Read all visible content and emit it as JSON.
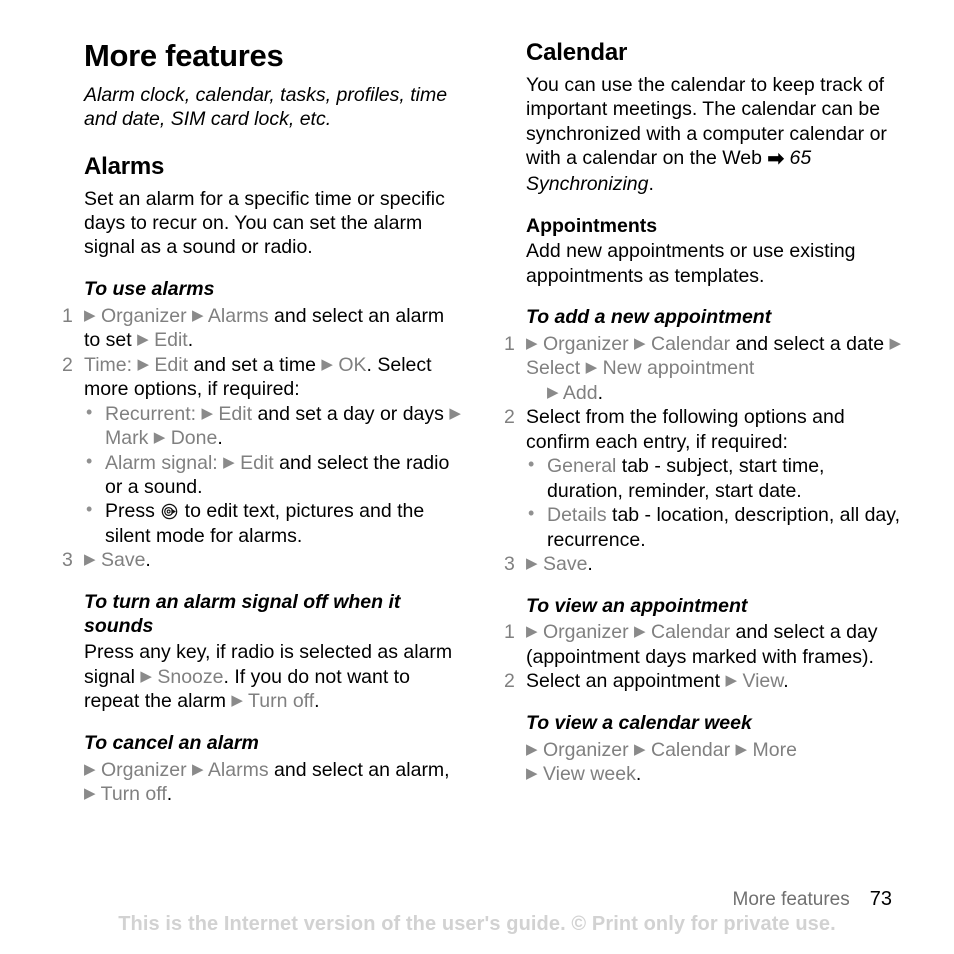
{
  "page": {
    "title": "More features",
    "subtitle": "Alarm clock, calendar, tasks, profiles, time and date, SIM card lock, etc.",
    "page_number": "73",
    "footer_section": "More features",
    "watermark": "This is the Internet version of the user's guide. © Print only for private use."
  },
  "colors": {
    "menu_path": "#808080",
    "body_text": "#000000",
    "watermark": "#d2d2d2"
  },
  "icons": {
    "menu_arrow": "▶",
    "cross_reference_arrow": "➡",
    "bullet": "•",
    "joystick": "joystick-icon"
  },
  "left_column": {
    "heading": "Alarms",
    "intro": "Set an alarm for a specific time or specific days to recur on. You can set the alarm signal as a sound or radio.",
    "procedures": [
      {
        "title": "To use alarms",
        "steps": [
          {
            "number": "1",
            "parts": [
              {
                "t": "arrow"
              },
              {
                "t": "mp",
                "v": "Organizer "
              },
              {
                "t": "arrow"
              },
              {
                "t": "mp",
                "v": "Alarms "
              },
              {
                "t": "plain",
                "v": "and select an alarm to set "
              },
              {
                "t": "arrow"
              },
              {
                "t": "mp",
                "v": "Edit"
              },
              {
                "t": "plain",
                "v": "."
              }
            ]
          },
          {
            "number": "2",
            "parts": [
              {
                "t": "mp",
                "v": "Time: "
              },
              {
                "t": "arrow"
              },
              {
                "t": "mp",
                "v": "Edit "
              },
              {
                "t": "plain",
                "v": "and set a time "
              },
              {
                "t": "arrow"
              },
              {
                "t": "mp",
                "v": "OK"
              },
              {
                "t": "plain",
                "v": ". Select more options, if required:"
              }
            ],
            "bullets": [
              [
                {
                  "t": "mp",
                  "v": "Recurrent: "
                },
                {
                  "t": "arrow"
                },
                {
                  "t": "mp",
                  "v": "Edit "
                },
                {
                  "t": "plain",
                  "v": "and set a day or days "
                },
                {
                  "t": "arrow"
                },
                {
                  "t": "mp",
                  "v": "Mark "
                },
                {
                  "t": "arrow"
                },
                {
                  "t": "mp",
                  "v": "Done"
                },
                {
                  "t": "plain",
                  "v": "."
                }
              ],
              [
                {
                  "t": "mp",
                  "v": "Alarm signal: "
                },
                {
                  "t": "arrow"
                },
                {
                  "t": "mp",
                  "v": "Edit "
                },
                {
                  "t": "plain",
                  "v": "and select the radio or a sound."
                }
              ],
              [
                {
                  "t": "plain",
                  "v": "Press "
                },
                {
                  "t": "joystick"
                },
                {
                  "t": "plain",
                  "v": " to edit text, pictures and the silent mode for alarms."
                }
              ]
            ]
          },
          {
            "number": "3",
            "parts": [
              {
                "t": "arrow"
              },
              {
                "t": "mp",
                "v": "Save"
              },
              {
                "t": "plain",
                "v": "."
              }
            ]
          }
        ]
      },
      {
        "title": "To turn an alarm signal off when it sounds",
        "body_parts": [
          {
            "t": "plain",
            "v": "Press any key, if radio is selected as alarm signal "
          },
          {
            "t": "arrow"
          },
          {
            "t": "mp",
            "v": "Snooze"
          },
          {
            "t": "plain",
            "v": ". If you do not want to repeat the alarm "
          },
          {
            "t": "arrow"
          },
          {
            "t": "mp",
            "v": "Turn off"
          },
          {
            "t": "plain",
            "v": "."
          }
        ]
      },
      {
        "title": "To cancel an alarm",
        "body_parts": [
          {
            "t": "arrow"
          },
          {
            "t": "mp",
            "v": "Organizer "
          },
          {
            "t": "arrow"
          },
          {
            "t": "mp",
            "v": "Alarms "
          },
          {
            "t": "plain",
            "v": "and select an alarm, "
          },
          {
            "t": "arrow"
          },
          {
            "t": "mp",
            "v": "Turn off"
          },
          {
            "t": "plain",
            "v": "."
          }
        ]
      }
    ]
  },
  "right_column": {
    "heading": "Calendar",
    "intro_parts": [
      {
        "t": "plain",
        "v": "You can use the calendar to keep track of important meetings. The calendar can be synchronized with a computer calendar or with a calendar on the Web "
      },
      {
        "t": "bigarrow"
      },
      {
        "t": "ital",
        "v": " 65 Synchronizing"
      },
      {
        "t": "plain",
        "v": "."
      }
    ],
    "subsection": {
      "title": "Appointments",
      "intro": "Add new appointments or use existing appointments as templates."
    },
    "procedures": [
      {
        "title": "To add a new appointment",
        "steps": [
          {
            "number": "1",
            "parts": [
              {
                "t": "arrow"
              },
              {
                "t": "mp",
                "v": "Organizer "
              },
              {
                "t": "arrow"
              },
              {
                "t": "mp",
                "v": "Calendar "
              },
              {
                "t": "plain",
                "v": "and select a date "
              },
              {
                "t": "arrow"
              },
              {
                "t": "mp",
                "v": "Select "
              },
              {
                "t": "arrow"
              },
              {
                "t": "mp",
                "v": "New appointment"
              }
            ],
            "continuation": [
              {
                "t": "arrow"
              },
              {
                "t": "mp",
                "v": "Add"
              },
              {
                "t": "plain",
                "v": "."
              }
            ]
          },
          {
            "number": "2",
            "parts": [
              {
                "t": "plain",
                "v": "Select from the following options and confirm each entry, if required:"
              }
            ],
            "bullets": [
              [
                {
                  "t": "mp",
                  "v": "General "
                },
                {
                  "t": "plain",
                  "v": "tab - subject, start time, duration, reminder, start date."
                }
              ],
              [
                {
                  "t": "mp",
                  "v": "Details "
                },
                {
                  "t": "plain",
                  "v": "tab - location, description, all day, recurrence."
                }
              ]
            ]
          },
          {
            "number": "3",
            "parts": [
              {
                "t": "arrow"
              },
              {
                "t": "mp",
                "v": "Save"
              },
              {
                "t": "plain",
                "v": "."
              }
            ]
          }
        ]
      },
      {
        "title": "To view an appointment",
        "steps": [
          {
            "number": "1",
            "parts": [
              {
                "t": "arrow"
              },
              {
                "t": "mp",
                "v": "Organizer "
              },
              {
                "t": "arrow"
              },
              {
                "t": "mp",
                "v": "Calendar "
              },
              {
                "t": "plain",
                "v": "and select a day (appointment days marked with frames)."
              }
            ]
          },
          {
            "number": "2",
            "parts": [
              {
                "t": "plain",
                "v": "Select an appointment "
              },
              {
                "t": "arrow"
              },
              {
                "t": "mp",
                "v": "View"
              },
              {
                "t": "plain",
                "v": "."
              }
            ]
          }
        ]
      },
      {
        "title": "To view a calendar week",
        "steps": [
          {
            "number": "",
            "parts": [
              {
                "t": "arrow"
              },
              {
                "t": "mp",
                "v": "Organizer "
              },
              {
                "t": "arrow"
              },
              {
                "t": "mp",
                "v": "Calendar "
              },
              {
                "t": "arrow"
              },
              {
                "t": "mp",
                "v": "More"
              }
            ],
            "continuation_flush": [
              {
                "t": "arrow"
              },
              {
                "t": "mp",
                "v": "View week"
              },
              {
                "t": "plain",
                "v": "."
              }
            ]
          }
        ]
      }
    ]
  }
}
